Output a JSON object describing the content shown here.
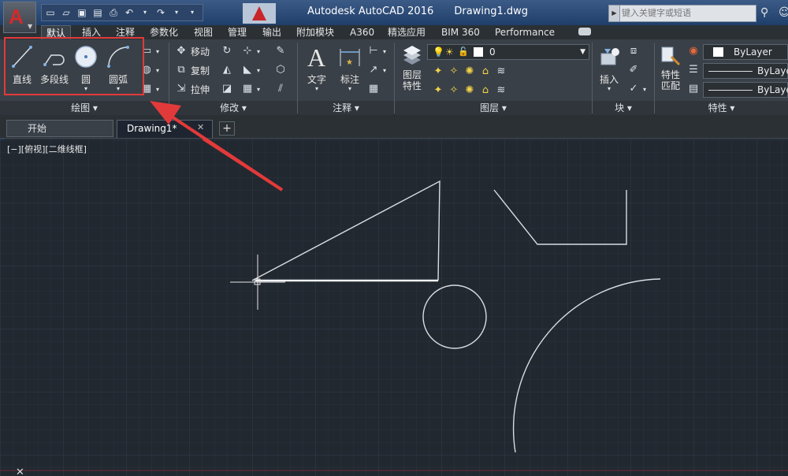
{
  "window": {
    "app_title": "Autodesk AutoCAD 2016",
    "file_name": "Drawing1.dwg",
    "search_placeholder": "键入关键字或短语"
  },
  "ribbon_tabs": [
    "默认",
    "插入",
    "注释",
    "参数化",
    "视图",
    "管理",
    "输出",
    "附加模块",
    "A360",
    "精选应用",
    "BIM 360",
    "Performance"
  ],
  "draw_panel": {
    "title": "绘图 ▾",
    "tools": [
      {
        "label": "直线",
        "icon": "line-icon"
      },
      {
        "label": "多段线",
        "icon": "polyline-icon"
      },
      {
        "label": "圆",
        "icon": "circle-icon"
      },
      {
        "label": "圆弧",
        "icon": "arc-icon"
      }
    ]
  },
  "modify_panel": {
    "title": "修改 ▾",
    "tools": [
      {
        "label": "移动",
        "icon": "move-icon"
      },
      {
        "label": "复制",
        "icon": "copy-icon"
      },
      {
        "label": "拉伸",
        "icon": "stretch-icon"
      }
    ]
  },
  "annotation_panel": {
    "title": "注释 ▾",
    "tools": [
      {
        "label": "文字",
        "icon": "text-icon"
      },
      {
        "label": "标注",
        "icon": "dimension-icon"
      }
    ]
  },
  "layers_panel": {
    "title": "图层 ▾",
    "tool_label": "图层\n特性",
    "current_layer": "0"
  },
  "block_panel": {
    "title": "块 ▾",
    "insert_label": "插入"
  },
  "properties_panel": {
    "title": "特性 ▾",
    "match_label": "特性\n匹配",
    "color_value": "ByLayer",
    "linetype_value": "ByLayer",
    "lineweight_value": "ByLayer"
  },
  "doc_tabs": {
    "start_label": "开始",
    "drawing_label": "Drawing1*"
  },
  "viewport_label": "[−][俯视][二维线框]",
  "colors": {
    "canvas_bg": "#212830",
    "highlight": "#e23a3a",
    "linework": "#d9dde3"
  }
}
